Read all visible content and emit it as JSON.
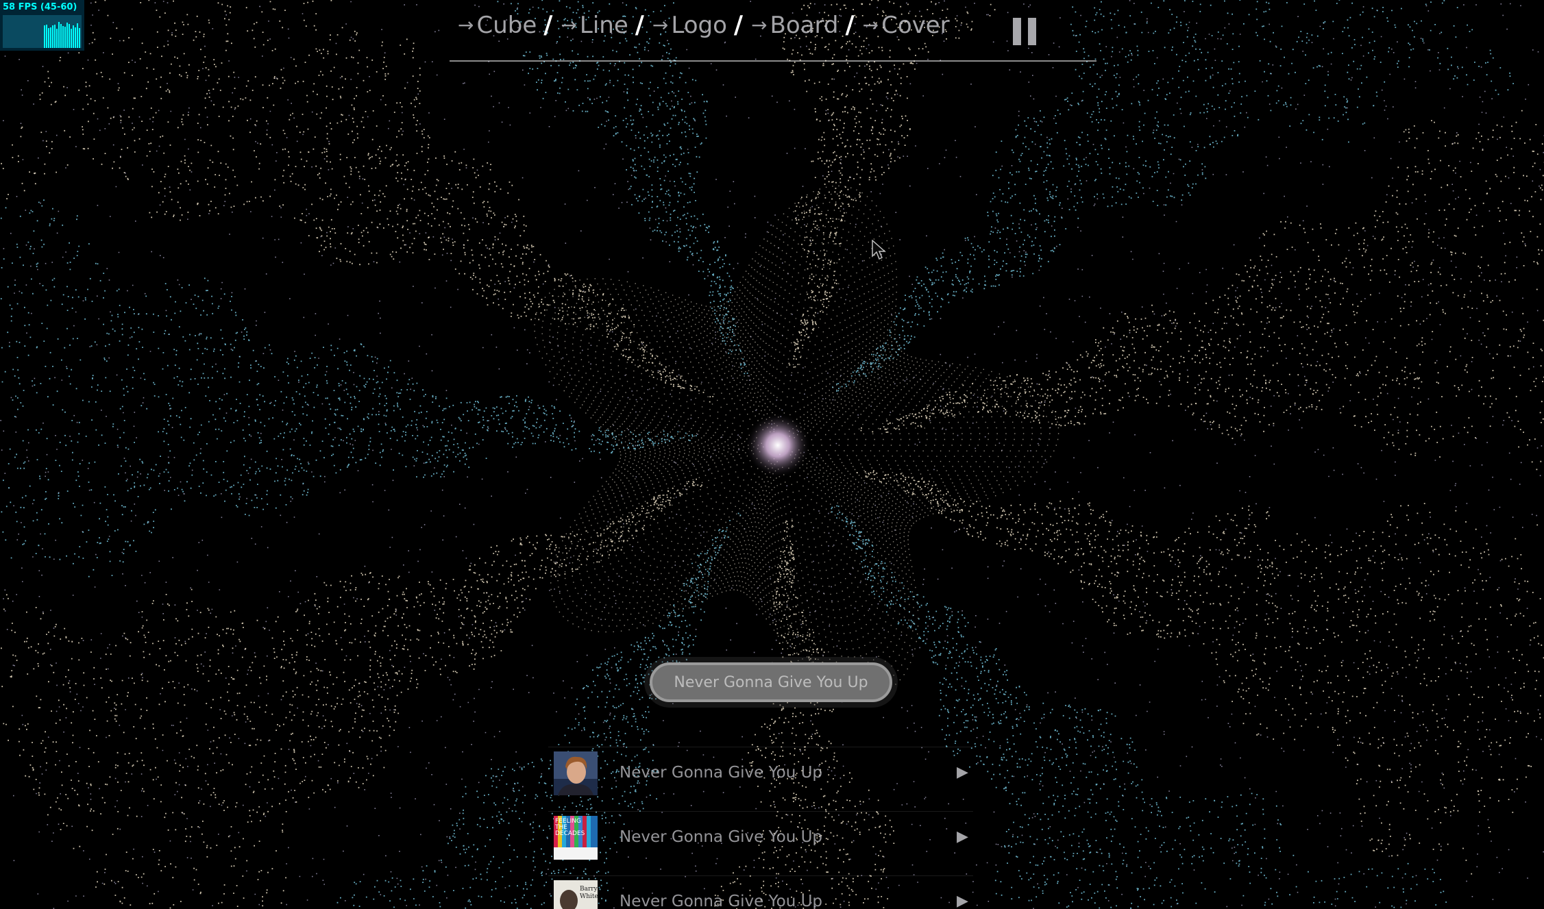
{
  "fps": {
    "label": "58 FPS (45-60)",
    "color": "#00ffff"
  },
  "nav": {
    "items": [
      {
        "label": "Cube",
        "icon": "arrow-right-icon"
      },
      {
        "label": "Line",
        "icon": "arrow-right-icon"
      },
      {
        "label": "Logo",
        "icon": "arrow-right-icon"
      },
      {
        "label": "Board",
        "icon": "arrow-right-icon"
      },
      {
        "label": "Cover",
        "icon": "arrow-right-icon"
      }
    ],
    "separator": "/",
    "pause_icon": "pause-icon"
  },
  "search": {
    "placeholder": "Never Gonna Give You Up",
    "value": ""
  },
  "results": [
    {
      "title": "Never Gonna Give You Up",
      "thumb": "rick-astley-portrait",
      "play_icon": "play-icon"
    },
    {
      "title": "Never Gonna Give You Up",
      "thumb": "feeling-decades-cover",
      "thumb_text": "FEELING THE DECADES",
      "play_icon": "play-icon"
    },
    {
      "title": "Never Gonna Give You Up",
      "thumb": "barry-white-cover",
      "thumb_text": "Barry White",
      "play_icon": "play-icon"
    }
  ],
  "visualizer": {
    "palette": [
      "#ffffff",
      "#fff1d6",
      "#e6b8de",
      "#8fa0ff",
      "#7fd6f0",
      "#5a6fd8"
    ]
  }
}
